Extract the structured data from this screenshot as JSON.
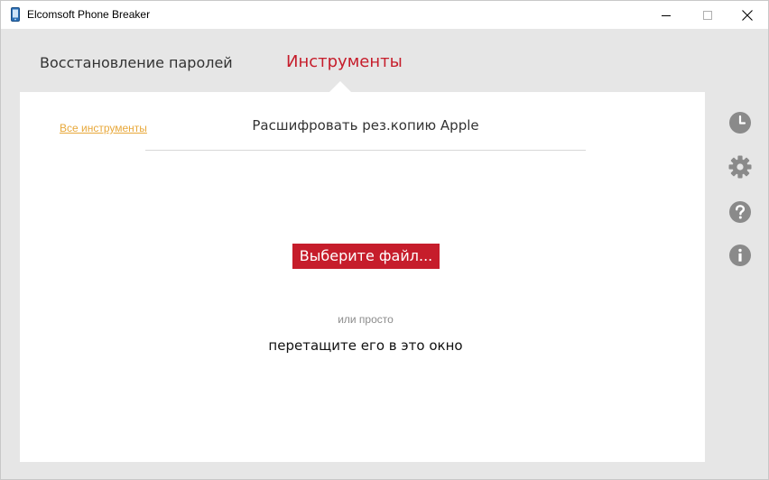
{
  "window": {
    "title": "Elcomsoft Phone Breaker"
  },
  "nav": {
    "tabs": [
      {
        "label": "Восстановление паролей",
        "active": false
      },
      {
        "label": "Инструменты",
        "active": true
      }
    ]
  },
  "panel": {
    "all_tools_link": "Все инструменты",
    "title": "Расшифровать рез.копию Apple",
    "choose_file_button": "Выберите файл...",
    "or_text": "или просто",
    "drag_text": "перетащите его в это окно"
  },
  "side_icons": [
    "history-icon",
    "gear-icon",
    "help-icon",
    "info-icon"
  ],
  "colors": {
    "accent": "#c61d2b",
    "link": "#e8a83a",
    "icon_gray": "#8a8a8a",
    "background": "#e6e6e6",
    "panel": "#ffffff"
  }
}
